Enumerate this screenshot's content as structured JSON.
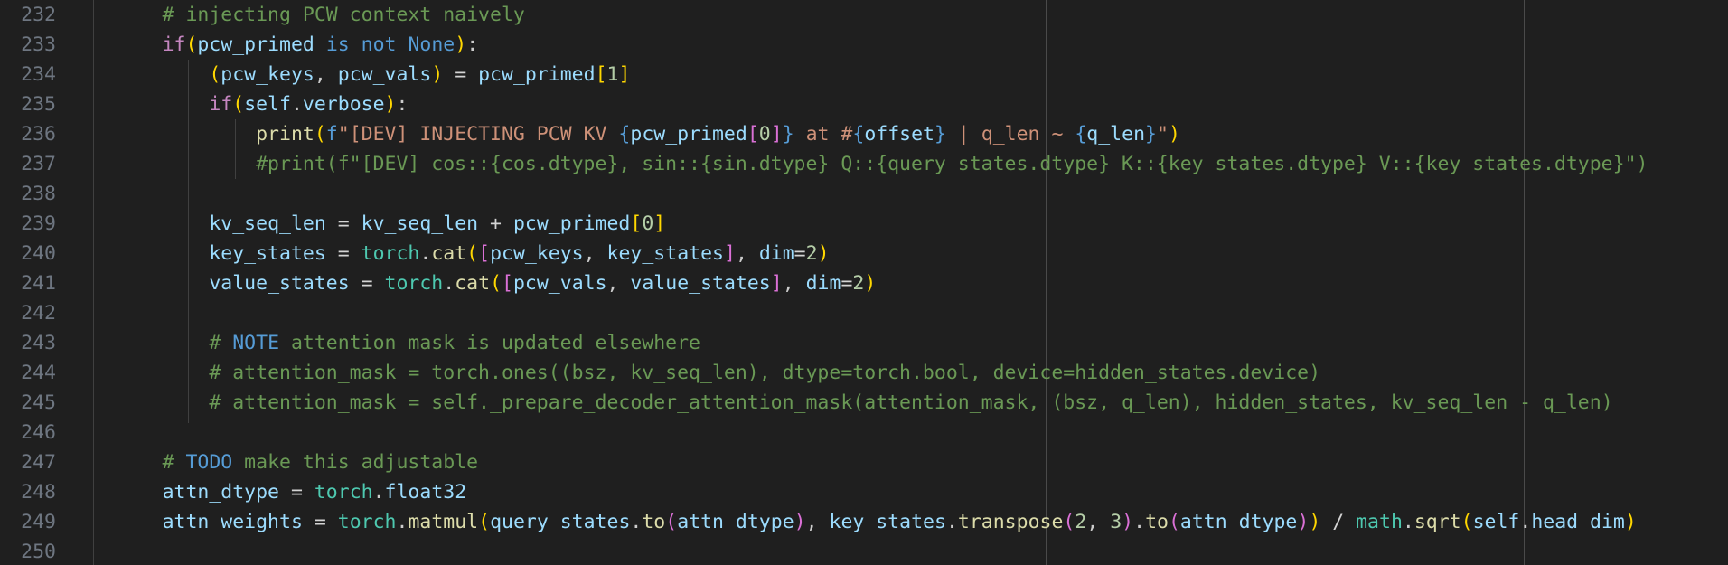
{
  "editor": {
    "language": "python",
    "first_line_number": 232,
    "lines": [
      {
        "number": "232",
        "tokens": [
          {
            "t": "        ",
            "c": "tk-plain"
          },
          {
            "t": "# injecting PCW context naively",
            "c": "tk-comment"
          }
        ]
      },
      {
        "number": "233",
        "tokens": [
          {
            "t": "        ",
            "c": "tk-plain"
          },
          {
            "t": "if",
            "c": "tk-kw-ctrl"
          },
          {
            "t": "(",
            "c": "tk-b1"
          },
          {
            "t": "pcw_primed",
            "c": "tk-var"
          },
          {
            "t": " ",
            "c": "tk-plain"
          },
          {
            "t": "is",
            "c": "tk-kw"
          },
          {
            "t": " ",
            "c": "tk-plain"
          },
          {
            "t": "not",
            "c": "tk-kw"
          },
          {
            "t": " ",
            "c": "tk-plain"
          },
          {
            "t": "None",
            "c": "tk-kw"
          },
          {
            "t": ")",
            "c": "tk-b1"
          },
          {
            "t": ":",
            "c": "tk-plain"
          }
        ]
      },
      {
        "number": "234",
        "tokens": [
          {
            "t": "            ",
            "c": "tk-plain"
          },
          {
            "t": "(",
            "c": "tk-b1"
          },
          {
            "t": "pcw_keys",
            "c": "tk-var"
          },
          {
            "t": ", ",
            "c": "tk-plain"
          },
          {
            "t": "pcw_vals",
            "c": "tk-var"
          },
          {
            "t": ")",
            "c": "tk-b1"
          },
          {
            "t": " = ",
            "c": "tk-op"
          },
          {
            "t": "pcw_primed",
            "c": "tk-var"
          },
          {
            "t": "[",
            "c": "tk-b1"
          },
          {
            "t": "1",
            "c": "tk-num"
          },
          {
            "t": "]",
            "c": "tk-b1"
          }
        ]
      },
      {
        "number": "235",
        "tokens": [
          {
            "t": "            ",
            "c": "tk-plain"
          },
          {
            "t": "if",
            "c": "tk-kw-ctrl"
          },
          {
            "t": "(",
            "c": "tk-b1"
          },
          {
            "t": "self",
            "c": "tk-var"
          },
          {
            "t": ".",
            "c": "tk-plain"
          },
          {
            "t": "verbose",
            "c": "tk-var"
          },
          {
            "t": ")",
            "c": "tk-b1"
          },
          {
            "t": ":",
            "c": "tk-plain"
          }
        ]
      },
      {
        "number": "236",
        "tokens": [
          {
            "t": "                ",
            "c": "tk-plain"
          },
          {
            "t": "print",
            "c": "tk-fn"
          },
          {
            "t": "(",
            "c": "tk-b1"
          },
          {
            "t": "f",
            "c": "tk-fprefix"
          },
          {
            "t": "\"[DEV] INJECTING PCW KV ",
            "c": "tk-str"
          },
          {
            "t": "{",
            "c": "tk-interp"
          },
          {
            "t": "pcw_primed",
            "c": "tk-var"
          },
          {
            "t": "[",
            "c": "tk-b2"
          },
          {
            "t": "0",
            "c": "tk-num"
          },
          {
            "t": "]",
            "c": "tk-b2"
          },
          {
            "t": "}",
            "c": "tk-interp"
          },
          {
            "t": " at #",
            "c": "tk-str"
          },
          {
            "t": "{",
            "c": "tk-interp"
          },
          {
            "t": "offset",
            "c": "tk-var"
          },
          {
            "t": "}",
            "c": "tk-interp"
          },
          {
            "t": " | q_len ~ ",
            "c": "tk-str"
          },
          {
            "t": "{",
            "c": "tk-interp"
          },
          {
            "t": "q_len",
            "c": "tk-var"
          },
          {
            "t": "}",
            "c": "tk-interp"
          },
          {
            "t": "\"",
            "c": "tk-str"
          },
          {
            "t": ")",
            "c": "tk-b1"
          }
        ]
      },
      {
        "number": "237",
        "tokens": [
          {
            "t": "                ",
            "c": "tk-plain"
          },
          {
            "t": "#print(f\"[DEV] cos::{cos.dtype}, sin::{sin.dtype} Q::{query_states.dtype} K::{key_states.dtype} V::{key_states.dtype}\")",
            "c": "tk-comment"
          }
        ]
      },
      {
        "number": "238",
        "tokens": []
      },
      {
        "number": "239",
        "tokens": [
          {
            "t": "            ",
            "c": "tk-plain"
          },
          {
            "t": "kv_seq_len",
            "c": "tk-var"
          },
          {
            "t": " = ",
            "c": "tk-op"
          },
          {
            "t": "kv_seq_len",
            "c": "tk-var"
          },
          {
            "t": " + ",
            "c": "tk-op"
          },
          {
            "t": "pcw_primed",
            "c": "tk-var"
          },
          {
            "t": "[",
            "c": "tk-b1"
          },
          {
            "t": "0",
            "c": "tk-num"
          },
          {
            "t": "]",
            "c": "tk-b1"
          }
        ]
      },
      {
        "number": "240",
        "tokens": [
          {
            "t": "            ",
            "c": "tk-plain"
          },
          {
            "t": "key_states",
            "c": "tk-var"
          },
          {
            "t": " = ",
            "c": "tk-op"
          },
          {
            "t": "torch",
            "c": "tk-type"
          },
          {
            "t": ".",
            "c": "tk-plain"
          },
          {
            "t": "cat",
            "c": "tk-fn"
          },
          {
            "t": "(",
            "c": "tk-b1"
          },
          {
            "t": "[",
            "c": "tk-b2"
          },
          {
            "t": "pcw_keys",
            "c": "tk-var"
          },
          {
            "t": ", ",
            "c": "tk-plain"
          },
          {
            "t": "key_states",
            "c": "tk-var"
          },
          {
            "t": "]",
            "c": "tk-b2"
          },
          {
            "t": ", ",
            "c": "tk-plain"
          },
          {
            "t": "dim",
            "c": "tk-var"
          },
          {
            "t": "=",
            "c": "tk-op"
          },
          {
            "t": "2",
            "c": "tk-num"
          },
          {
            "t": ")",
            "c": "tk-b1"
          }
        ]
      },
      {
        "number": "241",
        "tokens": [
          {
            "t": "            ",
            "c": "tk-plain"
          },
          {
            "t": "value_states",
            "c": "tk-var"
          },
          {
            "t": " = ",
            "c": "tk-op"
          },
          {
            "t": "torch",
            "c": "tk-type"
          },
          {
            "t": ".",
            "c": "tk-plain"
          },
          {
            "t": "cat",
            "c": "tk-fn"
          },
          {
            "t": "(",
            "c": "tk-b1"
          },
          {
            "t": "[",
            "c": "tk-b2"
          },
          {
            "t": "pcw_vals",
            "c": "tk-var"
          },
          {
            "t": ", ",
            "c": "tk-plain"
          },
          {
            "t": "value_states",
            "c": "tk-var"
          },
          {
            "t": "]",
            "c": "tk-b2"
          },
          {
            "t": ", ",
            "c": "tk-plain"
          },
          {
            "t": "dim",
            "c": "tk-var"
          },
          {
            "t": "=",
            "c": "tk-op"
          },
          {
            "t": "2",
            "c": "tk-num"
          },
          {
            "t": ")",
            "c": "tk-b1"
          }
        ]
      },
      {
        "number": "242",
        "tokens": []
      },
      {
        "number": "243",
        "tokens": [
          {
            "t": "            ",
            "c": "tk-plain"
          },
          {
            "t": "# ",
            "c": "tk-comment"
          },
          {
            "t": "NOTE",
            "c": "tk-note"
          },
          {
            "t": " attention_mask is updated elsewhere",
            "c": "tk-comment"
          }
        ]
      },
      {
        "number": "244",
        "tokens": [
          {
            "t": "            ",
            "c": "tk-plain"
          },
          {
            "t": "# attention_mask = torch.ones((bsz, kv_seq_len), dtype=torch.bool, device=hidden_states.device)",
            "c": "tk-comment"
          }
        ]
      },
      {
        "number": "245",
        "tokens": [
          {
            "t": "            ",
            "c": "tk-plain"
          },
          {
            "t": "# attention_mask = self._prepare_decoder_attention_mask(attention_mask, (bsz, q_len), hidden_states, kv_seq_len - q_len)",
            "c": "tk-comment"
          }
        ]
      },
      {
        "number": "246",
        "tokens": []
      },
      {
        "number": "247",
        "tokens": [
          {
            "t": "        ",
            "c": "tk-plain"
          },
          {
            "t": "# ",
            "c": "tk-comment"
          },
          {
            "t": "TODO",
            "c": "tk-note"
          },
          {
            "t": " make this adjustable",
            "c": "tk-comment"
          }
        ]
      },
      {
        "number": "248",
        "tokens": [
          {
            "t": "        ",
            "c": "tk-plain"
          },
          {
            "t": "attn_dtype",
            "c": "tk-var"
          },
          {
            "t": " = ",
            "c": "tk-op"
          },
          {
            "t": "torch",
            "c": "tk-type"
          },
          {
            "t": ".",
            "c": "tk-plain"
          },
          {
            "t": "float32",
            "c": "tk-var"
          }
        ]
      },
      {
        "number": "249",
        "tokens": [
          {
            "t": "        ",
            "c": "tk-plain"
          },
          {
            "t": "attn_weights",
            "c": "tk-var"
          },
          {
            "t": " = ",
            "c": "tk-op"
          },
          {
            "t": "torch",
            "c": "tk-type"
          },
          {
            "t": ".",
            "c": "tk-plain"
          },
          {
            "t": "matmul",
            "c": "tk-fn"
          },
          {
            "t": "(",
            "c": "tk-b1"
          },
          {
            "t": "query_states",
            "c": "tk-var"
          },
          {
            "t": ".",
            "c": "tk-plain"
          },
          {
            "t": "to",
            "c": "tk-fn"
          },
          {
            "t": "(",
            "c": "tk-b2"
          },
          {
            "t": "attn_dtype",
            "c": "tk-var"
          },
          {
            "t": ")",
            "c": "tk-b2"
          },
          {
            "t": ", ",
            "c": "tk-plain"
          },
          {
            "t": "key_states",
            "c": "tk-var"
          },
          {
            "t": ".",
            "c": "tk-plain"
          },
          {
            "t": "transpose",
            "c": "tk-fn"
          },
          {
            "t": "(",
            "c": "tk-b2"
          },
          {
            "t": "2",
            "c": "tk-num"
          },
          {
            "t": ", ",
            "c": "tk-plain"
          },
          {
            "t": "3",
            "c": "tk-num"
          },
          {
            "t": ")",
            "c": "tk-b2"
          },
          {
            "t": ".",
            "c": "tk-plain"
          },
          {
            "t": "to",
            "c": "tk-fn"
          },
          {
            "t": "(",
            "c": "tk-b2"
          },
          {
            "t": "attn_dtype",
            "c": "tk-var"
          },
          {
            "t": ")",
            "c": "tk-b2"
          },
          {
            "t": ")",
            "c": "tk-b1"
          },
          {
            "t": " / ",
            "c": "tk-op"
          },
          {
            "t": "math",
            "c": "tk-type"
          },
          {
            "t": ".",
            "c": "tk-plain"
          },
          {
            "t": "sqrt",
            "c": "tk-fn"
          },
          {
            "t": "(",
            "c": "tk-b1"
          },
          {
            "t": "self",
            "c": "tk-var"
          },
          {
            "t": ".",
            "c": "tk-plain"
          },
          {
            "t": "head_dim",
            "c": "tk-var"
          },
          {
            "t": ")",
            "c": "tk-b1"
          }
        ]
      },
      {
        "number": "250",
        "tokens": []
      }
    ]
  },
  "theme": {
    "background": "#1f1f1f",
    "line_number_color": "#6e7681",
    "comment_color": "#6a9955",
    "keyword_color": "#569cd6",
    "control_keyword_color": "#c586c0",
    "variable_color": "#9cdcfe",
    "function_color": "#dcdcaa",
    "module_color": "#4ec9b0",
    "number_color": "#b5cea8",
    "string_color": "#ce9178",
    "bracket_level1_color": "#ffd700",
    "bracket_level2_color": "#da70d6"
  }
}
